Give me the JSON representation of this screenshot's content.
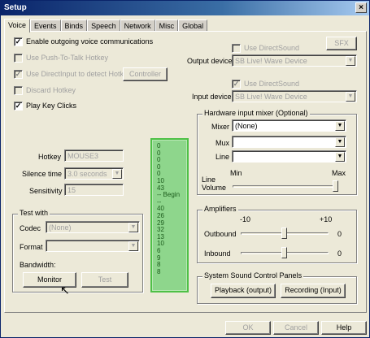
{
  "window": {
    "title": "Setup",
    "close_glyph": "×"
  },
  "tabs": [
    {
      "label": "Voice"
    },
    {
      "label": "Events"
    },
    {
      "label": "Binds"
    },
    {
      "label": "Speech"
    },
    {
      "label": "Network"
    },
    {
      "label": "Misc"
    },
    {
      "label": "Global"
    }
  ],
  "active_tab": "Voice",
  "options": {
    "enable_outgoing": {
      "label": "Enable outgoing voice communications",
      "checked": true
    },
    "push_to_talk": {
      "label": "Use Push-To-Talk Hotkey",
      "checked": false,
      "disabled": true
    },
    "directinput": {
      "label": "Use DirectInput to detect Hotkey",
      "checked": true,
      "disabled": true
    },
    "controller_button": "Controller",
    "discard_hotkey": {
      "label": "Discard Hotkey",
      "checked": false,
      "disabled": true
    },
    "play_key_clicks": {
      "label": "Play Key Clicks",
      "checked": true
    }
  },
  "output": {
    "use_directsound": "Use DirectSound",
    "sfx_button": "SFX",
    "device_label": "Output device",
    "device_value": "SB Live! Wave Device"
  },
  "input": {
    "use_directsound": "Use DirectSound",
    "device_label": "Input device",
    "device_value": "SB Live! Wave Device"
  },
  "mixer": {
    "title": "Hardware input mixer (Optional)",
    "mixer_label": "Mixer",
    "mixer_value": "(None)",
    "mux_label": "Mux",
    "mux_value": "",
    "line_label": "Line",
    "line_value": "",
    "min_label": "Min",
    "max_label": "Max",
    "line_volume_label_1": "Line",
    "line_volume_label_2": "Volume",
    "line_volume_level": 1.0
  },
  "hotkey": {
    "hotkey_label": "Hotkey",
    "hotkey_value": "MOUSE3",
    "silence_label": "Silence time",
    "silence_value": "3.0 seconds",
    "sensitivity_label": "Sensitivity",
    "sensitivity_value": "15"
  },
  "testwith": {
    "title": "Test with",
    "codec_label": "Codec",
    "codec_value": "(None)",
    "format_label": "Format",
    "format_value": "",
    "bandwidth_label": "Bandwidth:",
    "monitor_button": "Monitor",
    "test_button": "Test"
  },
  "level_values": [
    "0",
    "0",
    "0",
    "0",
    "0",
    "10",
    "43",
    "-- Begin --",
    "40",
    "26",
    "29",
    "32",
    "13",
    "10",
    "6",
    "9",
    "8",
    "8"
  ],
  "amplifiers": {
    "title": "Amplifiers",
    "min_label": "-10",
    "max_label": "+10",
    "outbound_label": "Outbound",
    "outbound_value": "0",
    "inbound_label": "Inbound",
    "inbound_value": "0"
  },
  "sound_panels": {
    "title": "System Sound Control Panels",
    "playback_button": "Playback (output)",
    "recording_button": "Recording (Input)"
  },
  "footer": {
    "ok": "OK",
    "cancel": "Cancel",
    "help": "Help"
  }
}
